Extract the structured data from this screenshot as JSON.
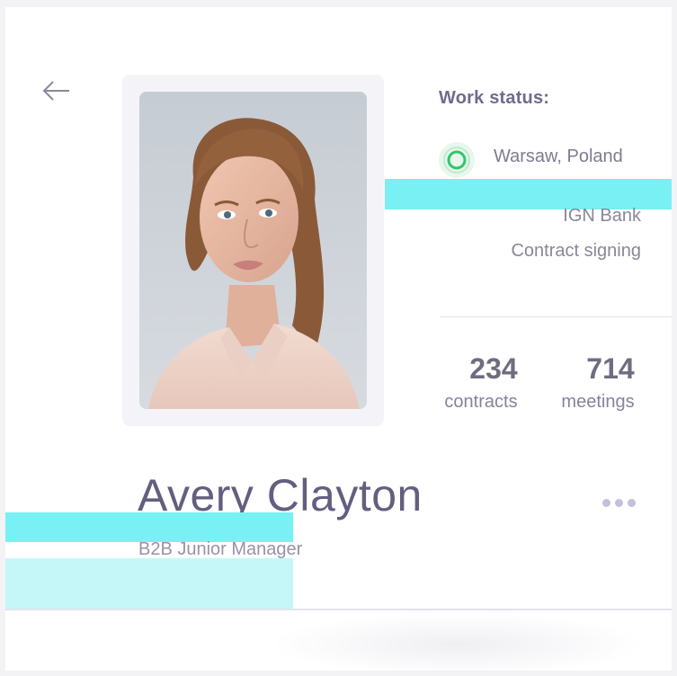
{
  "nav": {
    "back_icon": "arrow-left-icon"
  },
  "profile": {
    "name": "Avery Clayton",
    "role": "B2B Junior Manager",
    "photo_alt": "portrait-photo"
  },
  "work_status": {
    "title": "Work status:",
    "location": "Warsaw, Poland",
    "company": "IGN Bank",
    "stage": "Contract signing",
    "status_color": "#33c46a"
  },
  "stats": [
    {
      "value": "234",
      "label": "contracts"
    },
    {
      "value": "714",
      "label": "meetings"
    }
  ],
  "more_icon": "more-horizontal-icon",
  "colors": {
    "accent_text": "#635f7f",
    "highlight": "#79f0f4",
    "highlight_light": "#c5f7f9"
  }
}
